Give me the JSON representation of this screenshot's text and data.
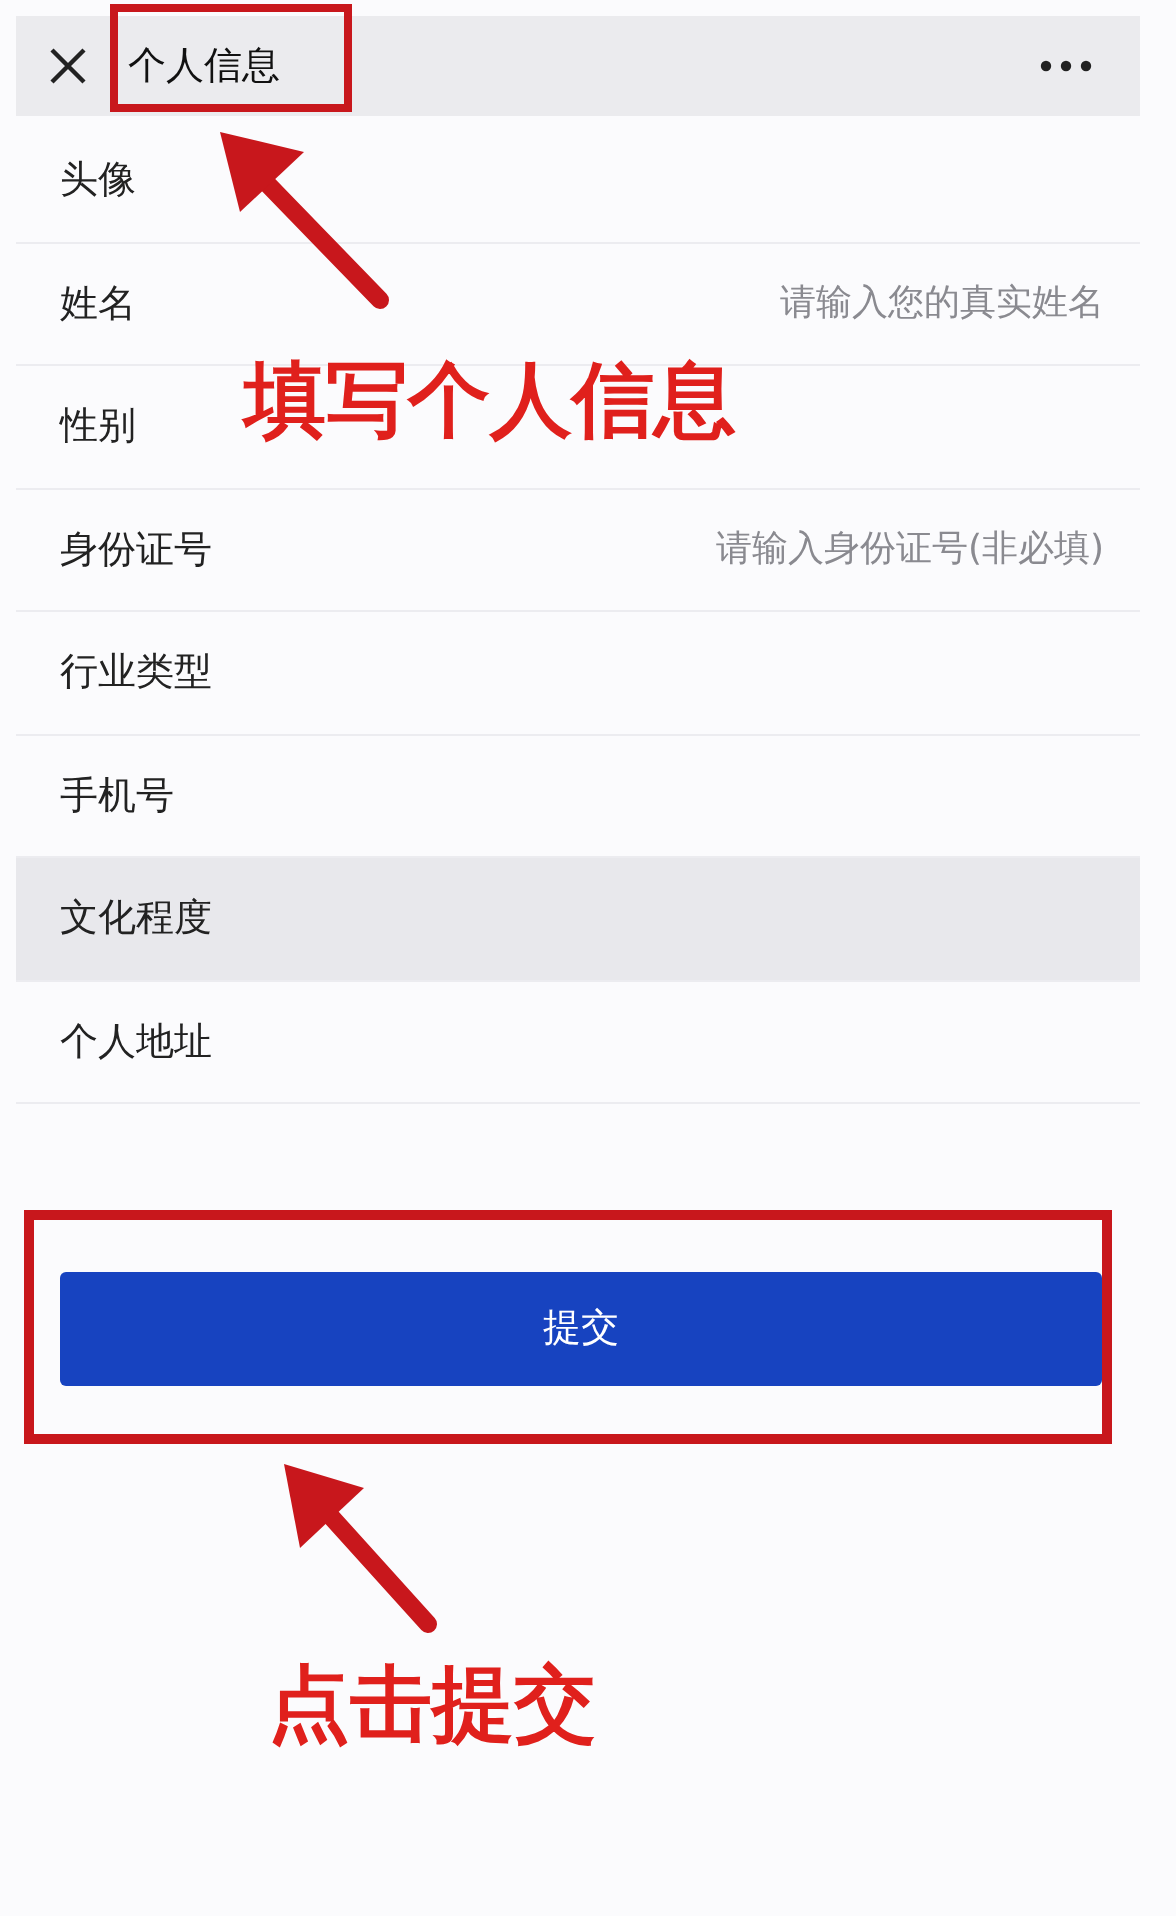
{
  "header": {
    "title": "个人信息"
  },
  "rows": [
    {
      "label": "头像",
      "highlighted": false
    },
    {
      "label": "姓名",
      "placeholder": "请输入您的真实姓名",
      "highlighted": false
    },
    {
      "label": "性别",
      "highlighted": false
    },
    {
      "label": "身份证号",
      "placeholder": "请输入身份证号(非必填)",
      "highlighted": false
    },
    {
      "label": "行业类型",
      "highlighted": false
    },
    {
      "label": "手机号",
      "highlighted": false
    },
    {
      "label": "文化程度",
      "highlighted": true
    },
    {
      "label": "个人地址",
      "highlighted": false
    }
  ],
  "submit_button": {
    "label": "提交"
  },
  "annotations": [
    {
      "kind": "title",
      "text": "填写个人信息"
    },
    {
      "kind": "button",
      "text": "点击提交"
    }
  ]
}
